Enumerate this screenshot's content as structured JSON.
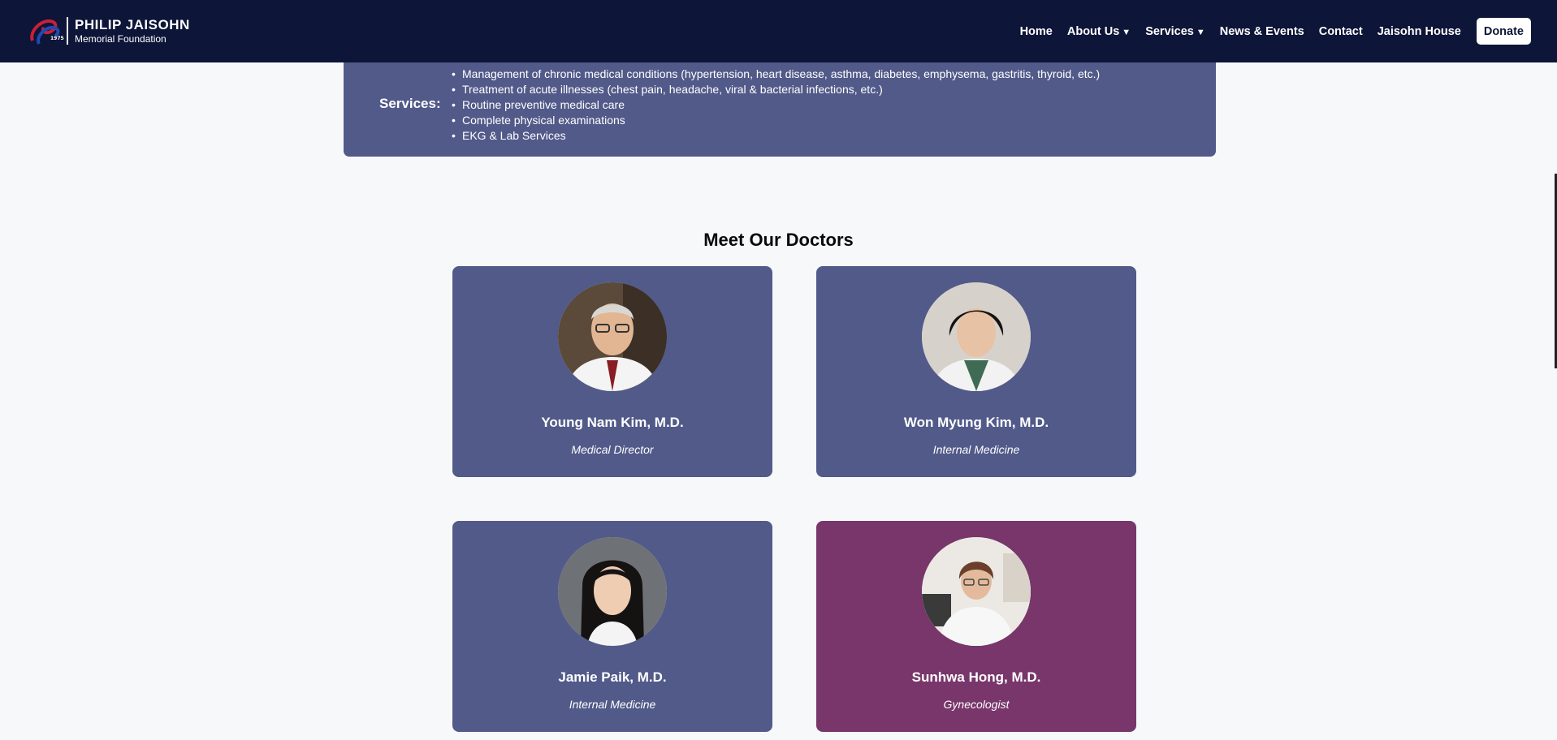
{
  "brand": {
    "year": "1975",
    "line1": "PHILIP JAISOHN",
    "line2": "Memorial Foundation"
  },
  "nav": {
    "items": [
      {
        "label": "Home",
        "caret": ""
      },
      {
        "label": "About Us",
        "caret": "▼"
      },
      {
        "label": "Services",
        "caret": "▼"
      },
      {
        "label": "News & Events",
        "caret": ""
      },
      {
        "label": "Contact",
        "caret": ""
      },
      {
        "label": "Jaisohn House",
        "caret": ""
      }
    ],
    "donate_label": "Donate"
  },
  "services": {
    "label": "Services:",
    "items": [
      "Management of chronic medical conditions (hypertension, heart disease, asthma, diabetes, emphysema, gastritis, thyroid, etc.)",
      "Treatment of acute illnesses (chest pain, headache, viral & bacterial infections, etc.)",
      "Routine preventive medical care",
      "Complete physical examinations",
      "EKG & Lab Services"
    ]
  },
  "doctors_section": {
    "title": "Meet Our Doctors",
    "doctors": [
      {
        "name": "Young Nam Kim, M.D.",
        "role": "Medical Director"
      },
      {
        "name": "Won Myung Kim, M.D.",
        "role": "Internal Medicine"
      },
      {
        "name": "Jamie Paik, M.D.",
        "role": "Internal Medicine"
      },
      {
        "name": "Sunhwa Hong, M.D.",
        "role": "Gynecologist"
      }
    ]
  },
  "colors": {
    "nav_bg": "#0d1538",
    "card_blue": "#515a89",
    "card_plum": "#78366b",
    "page_bg": "#f7f8fa"
  }
}
